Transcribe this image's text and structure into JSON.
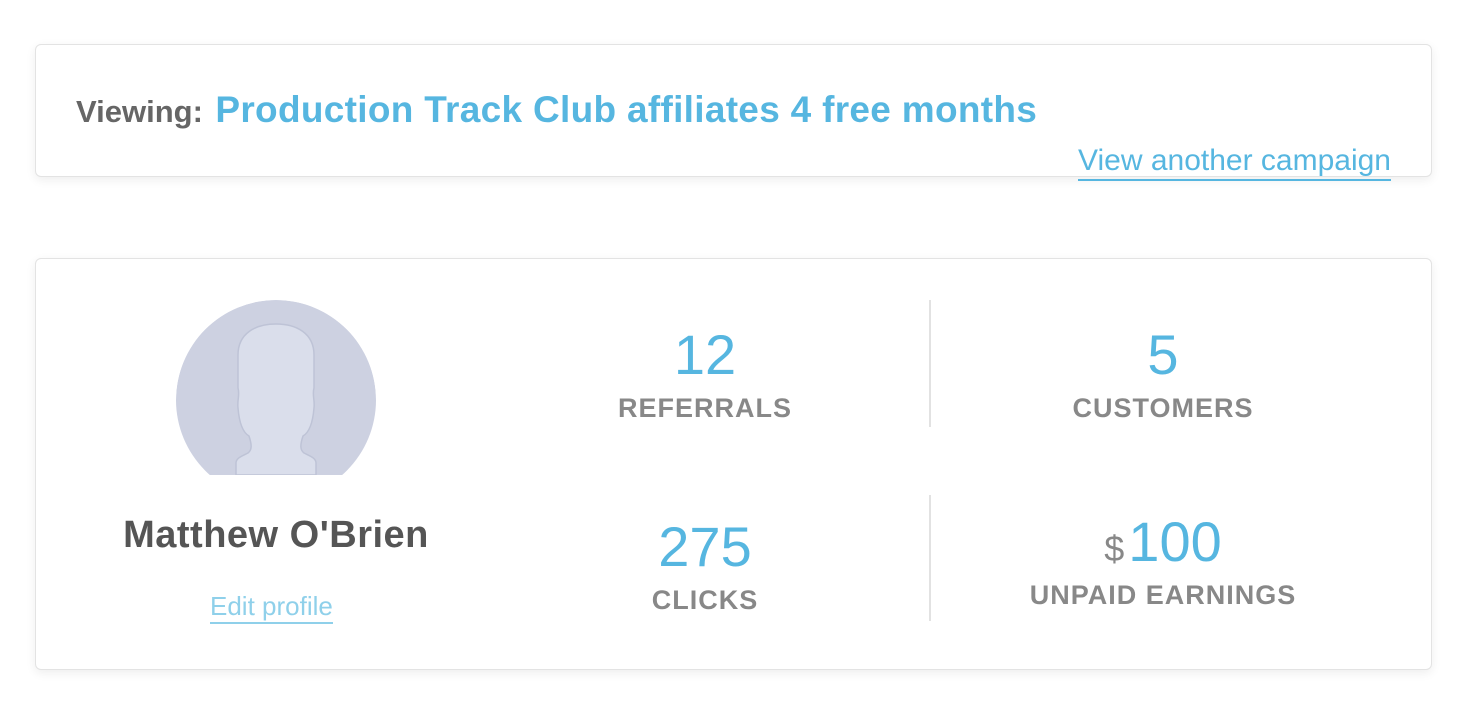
{
  "campaign": {
    "viewing_label": "Viewing:",
    "name": "Production Track Club affiliates 4 free months",
    "view_another_label": "View another campaign"
  },
  "profile": {
    "avatar_icon": "user-silhouette-icon",
    "name": "Matthew O'Brien",
    "edit_label": "Edit profile"
  },
  "stats": {
    "referrals": {
      "value": "12",
      "label": "REFERRALS"
    },
    "customers": {
      "value": "5",
      "label": "CUSTOMERS"
    },
    "clicks": {
      "value": "275",
      "label": "CLICKS"
    },
    "unpaid_earnings": {
      "currency": "$",
      "value": "100",
      "label": "UNPAID EARNINGS"
    }
  },
  "colors": {
    "accent": "#56b6e0",
    "edit_link": "#8fd0ea",
    "label_gray": "#888888",
    "avatar_bg": "#cdd1e1"
  }
}
